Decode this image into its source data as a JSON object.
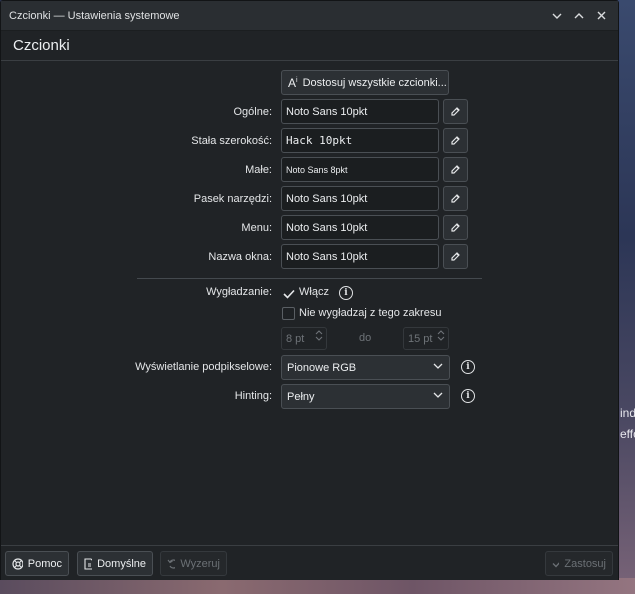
{
  "window": {
    "title": "Czcionki — Ustawienia systemowe"
  },
  "header": {
    "title": "Czcionki"
  },
  "adjust_all_button": {
    "label": "Dostosuj wszystkie czcionki..."
  },
  "fonts": [
    {
      "label": "Ogólne:",
      "value": "Noto Sans 10pkt"
    },
    {
      "label": "Stała szerokość:",
      "value": "Hack 10pkt"
    },
    {
      "label": "Małe:",
      "value": "Noto Sans 8pkt"
    },
    {
      "label": "Pasek narzędzi:",
      "value": "Noto Sans 10pkt"
    },
    {
      "label": "Menu:",
      "value": "Noto Sans 10pkt"
    },
    {
      "label": "Nazwa okna:",
      "value": "Noto Sans 10pkt"
    }
  ],
  "antialiasing": {
    "label": "Wygładzanie:",
    "enabled_label": "Włącz",
    "enabled": true,
    "exclude_label": "Nie wygładzaj z tego zakresu",
    "exclude_checked": false,
    "range_from": "8 pt",
    "range_to_label": "do",
    "range_to": "15 pt"
  },
  "subpixel": {
    "label": "Wyświetlanie podpikselowe:",
    "value": "Pionowe RGB"
  },
  "hinting": {
    "label": "Hinting:",
    "value": "Pełny"
  },
  "footer": {
    "help": "Pomoc",
    "defaults": "Domyślne",
    "reset": "Wyzeruj",
    "apply": "Zastosuj"
  },
  "desktop": {
    "line1": "ind",
    "line2": "effo"
  }
}
